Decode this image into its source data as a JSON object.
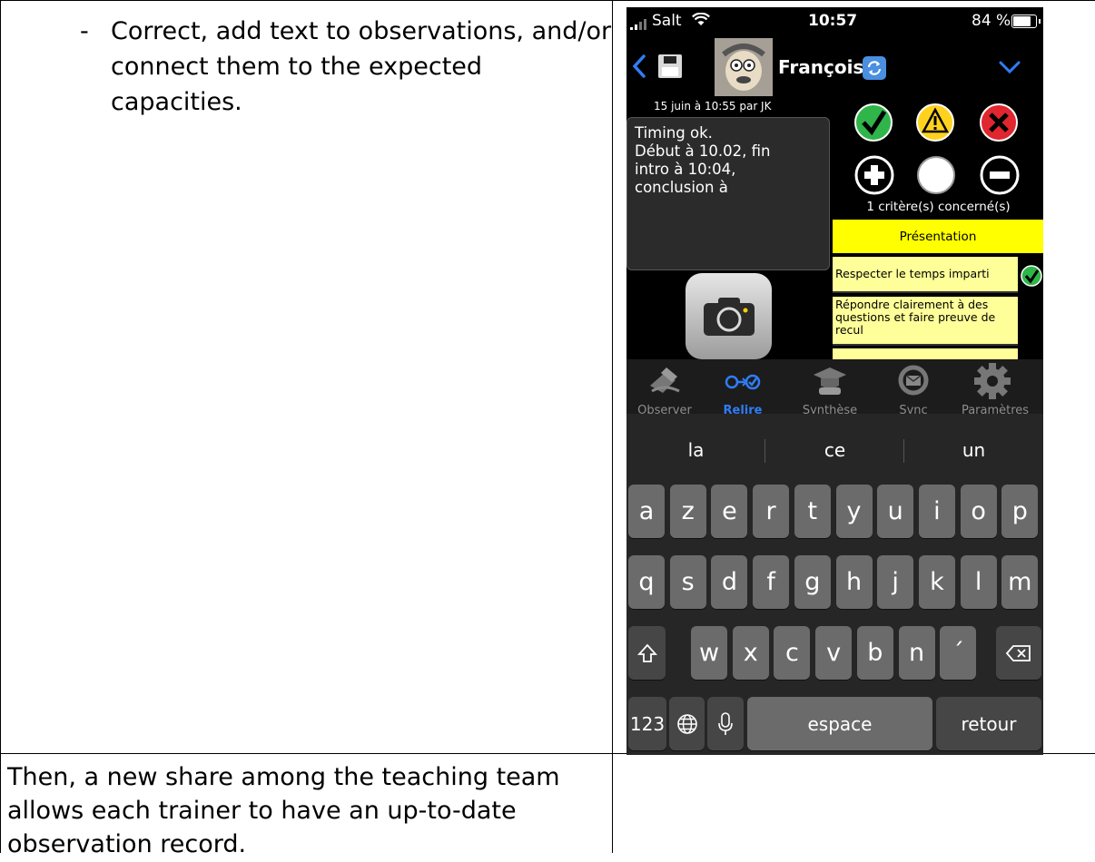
{
  "doc": {
    "bullet_dash": "-",
    "bullet_lines": [
      "Correct, add text to observations, and/or",
      "connect them to the expected",
      "capacities."
    ],
    "bottom_lines": [
      "Then, a new share among the teaching team",
      "allows each trainer to have an up-to-date",
      "observation record."
    ]
  },
  "status_bar": {
    "carrier": "Salt",
    "time": "10:57",
    "battery": "84 %"
  },
  "nav": {
    "student_name": "François"
  },
  "observation": {
    "meta": "15 juin à 10:55 par JK",
    "text_lines": [
      "Timing ok.",
      "Début à 10.02, fin",
      "intro à 10:04,",
      "conclusion à"
    ]
  },
  "criteria": {
    "count_label": "1 critère(s) concerné(s)",
    "category": "Présentation",
    "items": [
      {
        "label_lines": [
          "Respecter le temps imparti"
        ]
      },
      {
        "label_lines": [
          "Répondre clairement à des",
          "questions et faire preuve de",
          "recul"
        ]
      }
    ]
  },
  "tabbar": [
    {
      "label": "Observer",
      "icon": "observer-icon"
    },
    {
      "label": "Relire",
      "icon": "relire-icon"
    },
    {
      "label": "Synthèse",
      "icon": "synthese-icon"
    },
    {
      "label": "Sync",
      "icon": "sync-icon"
    },
    {
      "label": "Paramètres",
      "icon": "gear-icon"
    }
  ],
  "keyboard": {
    "suggestions": [
      "la",
      "ce",
      "un"
    ],
    "row1": [
      "a",
      "z",
      "e",
      "r",
      "t",
      "y",
      "u",
      "i",
      "o",
      "p"
    ],
    "row2": [
      "q",
      "s",
      "d",
      "f",
      "g",
      "h",
      "j",
      "k",
      "l",
      "m"
    ],
    "row3": [
      "w",
      "x",
      "c",
      "v",
      "b",
      "n",
      "´"
    ],
    "numbers_label": "123",
    "space_label": "espace",
    "return_label": "retour"
  },
  "colors": {
    "accent_blue": "#2f7df6",
    "yellow": "#ffff00",
    "pale_yellow": "#ffff99",
    "green_check": "#2fb54a",
    "red_x": "#e0262f",
    "warn_yellow": "#ffd21f"
  }
}
